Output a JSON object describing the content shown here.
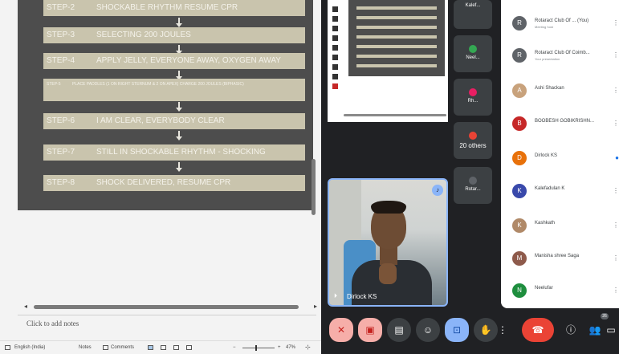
{
  "slide": {
    "steps": [
      {
        "num": "STEP-2",
        "text": "SHOCKABLE RHYTHM RESUME CPR"
      },
      {
        "num": "STEP-3",
        "text": "SELECTING 200 JOULES"
      },
      {
        "num": "STEP-4",
        "text": "APPLY JELLY, EVERYONE AWAY, OXYGEN AWAY"
      },
      {
        "num": "STEP-5",
        "text": "PLACE PADDLES (1 ON RIGHT STERNUM & 2 ON APEX) CHARGE 200 JOULES (BIPHASIC)"
      },
      {
        "num": "STEP-6",
        "text": "I AM CLEAR, EVERYBODY CLEAR"
      },
      {
        "num": "STEP-7",
        "text": "STILL IN SHOCKABLE RHYTHM - SHOCKING"
      },
      {
        "num": "STEP-8",
        "text": "SHOCK DELIVERED, RESUME CPR"
      }
    ]
  },
  "editor": {
    "notes_placeholder": "Click to add notes",
    "status": {
      "language": "English (India)",
      "notes_label": "Notes",
      "comments_label": "Comments",
      "zoom": "47%"
    }
  },
  "meet": {
    "tiles": [
      {
        "label": "Kalef...",
        "color": "#5f6368"
      },
      {
        "label": "Neel...",
        "color": "#34a853"
      },
      {
        "label": "Rh...",
        "color": "#e91e63"
      },
      {
        "label": "20 others",
        "color": "#ea4335"
      },
      {
        "label": "Rotar...",
        "color": "#5f6368"
      }
    ],
    "speaker_name": "Dirlock KS",
    "people": [
      {
        "name": "Rotaract Club Of ...  (You)",
        "sub": "Meeting host",
        "initial": "R",
        "color": "#5f6368",
        "action": "⋮"
      },
      {
        "name": "Rotaract Club Of Coimb...",
        "sub": "Your presentation",
        "initial": "R",
        "color": "#5f6368",
        "action": "⋮"
      },
      {
        "name": "Ashi Shackan",
        "sub": "",
        "initial": "A",
        "color": "#c8a27c",
        "action": "⋮"
      },
      {
        "name": "BOOBESH GOBIKRISHN...",
        "sub": "",
        "initial": "B",
        "color": "#c62828",
        "action": "⋮"
      },
      {
        "name": "Dirlock KS",
        "sub": "",
        "initial": "D",
        "color": "#e8710a",
        "action": "●"
      },
      {
        "name": "Kalefadulan K",
        "sub": "",
        "initial": "K",
        "color": "#3949ab",
        "action": "⋮"
      },
      {
        "name": "Kashkath",
        "sub": "",
        "initial": "K",
        "color": "#b08968",
        "action": "⋮"
      },
      {
        "name": "Manisha shree Saga",
        "sub": "",
        "initial": "M",
        "color": "#8e5a4b",
        "action": "⋮"
      },
      {
        "name": "Neelufar",
        "sub": "",
        "initial": "N",
        "color": "#1e8e3e",
        "action": "⋮"
      }
    ],
    "participant_count": "26"
  }
}
